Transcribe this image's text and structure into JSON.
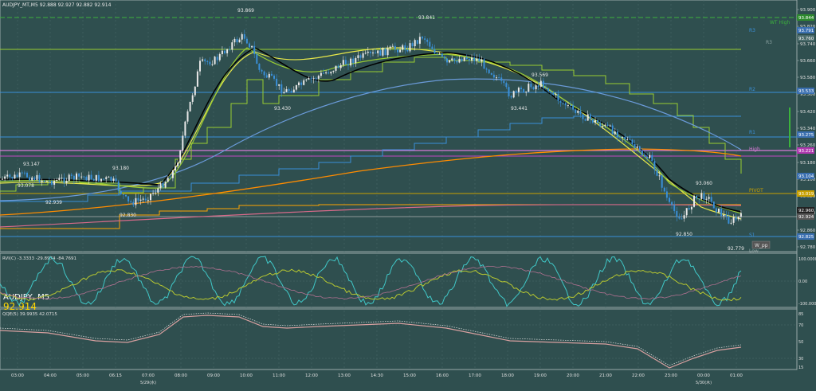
{
  "header": {
    "symbol_line": "AUDJPY_MT,M5  92.888 92.927 92.882 92.914"
  },
  "overlay": {
    "symbol_big": "AUDJPY, M5",
    "price_big": "92.914",
    "price_color": "#ffd700"
  },
  "indicator1_label": "RVI(C) -3.3333 -29.8974 -84.7691",
  "indicator2_label": "QQE(5) 39.9935 42.0715",
  "annotations": {
    "high_93869": "93.869",
    "high_93841": "93.841",
    "mid_93430": "93.430",
    "mid_93569": "93.569",
    "mid_93441": "93.441",
    "left_93147": "93.147",
    "left_93078": "93.078",
    "left_93180": "93.180",
    "left_92939": "92.939",
    "low_92830": "92.830",
    "right_93060": "93.060",
    "low_92850": "92.850",
    "low_92779": "92.779"
  },
  "level_labels": {
    "wt_high": "WT High",
    "r3": "R3",
    "r3b": "R3",
    "r2": "R2",
    "r1": "R1",
    "high": "High",
    "pivot": "PIVOT",
    "s1": "S1",
    "low": "Low",
    "w_pp": "W_pp"
  },
  "price_axis": {
    "ticks": [
      "93.900",
      "93.820",
      "93.740",
      "93.660",
      "93.580",
      "93.500",
      "93.420",
      "93.340",
      "93.260",
      "93.180",
      "93.100",
      "93.020",
      "92.940",
      "92.860",
      "92.780"
    ],
    "boxes": [
      {
        "text": "93.844",
        "color": "#2e8b2e"
      },
      {
        "text": "93.791",
        "color": "#3a6fb0"
      },
      {
        "text": "93.760",
        "color": "#4a6a6a"
      },
      {
        "text": "93.533",
        "color": "#3a6fb0"
      },
      {
        "text": "93.275",
        "color": "#3a6fb0"
      },
      {
        "text": "93.221",
        "color": "#b03ab0"
      },
      {
        "text": "93.104",
        "color": "#3a6fb0"
      },
      {
        "text": "93.019",
        "color": "#c8a000"
      },
      {
        "text": "92.960",
        "color": "#222222"
      },
      {
        "text": "92.924",
        "color": "#555555"
      },
      {
        "text": "92.825",
        "color": "#3a6fb0"
      }
    ]
  },
  "ind1_axis": [
    "100.0000",
    "0.00",
    "-100.0000"
  ],
  "ind2_axis": [
    "85",
    "70",
    "50",
    "30",
    "15"
  ],
  "time_axis": [
    "03:00",
    "04:00",
    "05:00",
    "06:15",
    "07:00",
    "08:00",
    "09:00",
    "10:00",
    "11:00",
    "12:00",
    "13:00",
    "14:30",
    "15:00",
    "16:00",
    "17:00",
    "18:00",
    "19:00",
    "20:00",
    "21:00",
    "22:00",
    "23:00",
    "00:00",
    "01:00"
  ],
  "date_labels": [
    "5/29(水)",
    "5/30(木)"
  ],
  "colors": {
    "bg": "#2f4f4f",
    "bull": "#e8e8e8",
    "bear": "#3a8fd8",
    "grid": "#4a6a6a",
    "ma_black": "#000000",
    "ma_yellow": "#e8e84a",
    "ma_green": "#9acd32",
    "ma_blue": "#6a9ad8",
    "ma_orange": "#ff8c00"
  }
}
